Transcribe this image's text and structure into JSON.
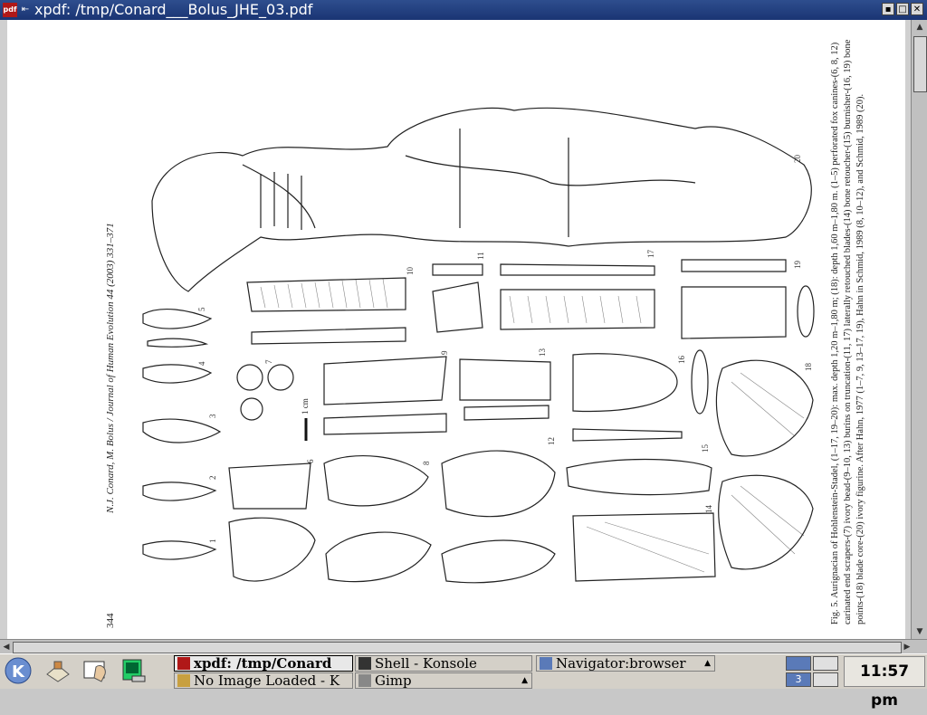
{
  "window": {
    "title": "xpdf: /tmp/Conard___Bolus_JHE_03.pdf",
    "app_icon": "pdf",
    "buttons": [
      "minimize",
      "maximize",
      "close"
    ]
  },
  "page": {
    "header": "N.J. Conard, M. Bolus / Journal of Human Evolution 44 (2003) 331–371",
    "page_number": "344",
    "scale_label": "1 cm",
    "figure_numbers": [
      "1",
      "2",
      "3",
      "4",
      "5",
      "6",
      "7",
      "8",
      "9",
      "10",
      "11",
      "12",
      "13",
      "14",
      "15",
      "16",
      "17",
      "18",
      "19",
      "20"
    ],
    "caption": "Fig. 5. Aurignacian of Hohlenstein-Stadel, (1–17, 19–20): max. depth 1,20 m–1,80 m; (18): depth 1,60 m–1,80 m. (1–5) perforated fox canines-(6, 8, 12) carinated end scrapers-(7) ivory bead-(9–10, 13) burins on truncation-(11, 17) laterally retouched blades-(14) bone retoucher-(15) burnisher-(16, 19) bone points-(18) blade core-(20) ivory figurine. After Hahn, 1977 (1–7, 9, 13–17, 19), Hahn in Schmid, 1989 (8, 10–12), and Schmid, 1989 (20)."
  },
  "taskbar": {
    "tasks": [
      {
        "label": "xpdf: /tmp/Conard",
        "icon": "pdf-icon",
        "active": true
      },
      {
        "label": "Shell - Konsole",
        "icon": "terminal-icon",
        "active": false
      },
      {
        "label": "Navigator:browser",
        "icon": "browser-icon",
        "active": false
      },
      {
        "label": "No Image Loaded - K",
        "icon": "image-viewer-icon",
        "active": false
      },
      {
        "label": "Gimp",
        "icon": "gimp-icon",
        "active": false
      }
    ],
    "pager_label": "3",
    "clock": "11:57 pm"
  }
}
